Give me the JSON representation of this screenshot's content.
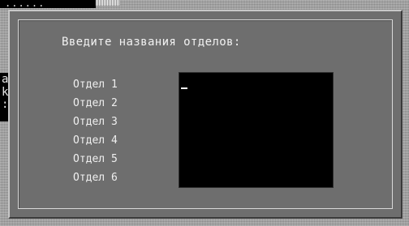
{
  "background": {
    "top_left_text": "......",
    "left_edge_lines": [
      "а",
      "k",
      ":"
    ]
  },
  "dialog": {
    "title": "Введите названия отделов:",
    "departments": [
      {
        "label": "Отдел 1"
      },
      {
        "label": "Отдел 2"
      },
      {
        "label": "Отдел 3"
      },
      {
        "label": "Отдел 4"
      },
      {
        "label": "Отдел 5"
      },
      {
        "label": "Отдел 6"
      }
    ],
    "input_value": ""
  },
  "colors": {
    "dialog_bg": "#6e6e6e",
    "input_bg": "#000000",
    "text": "#f2f2f2"
  }
}
